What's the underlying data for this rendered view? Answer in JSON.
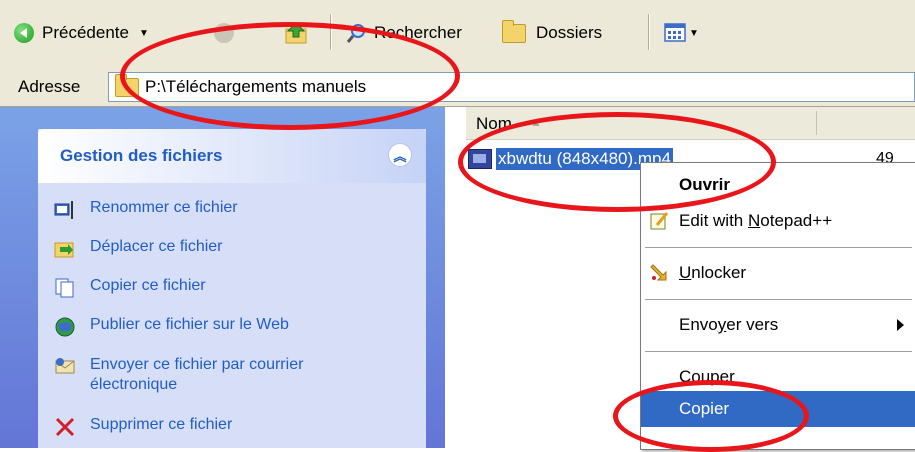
{
  "toolbar": {
    "back_label": "Précédente",
    "search_label": "Rechercher",
    "folders_label": "Dossiers"
  },
  "address": {
    "label": "Adresse",
    "path": "P:\\Téléchargements manuels"
  },
  "task_panel": {
    "title": "Gestion des fichiers",
    "tasks": [
      {
        "label": "Renommer ce fichier",
        "icon": "rename-icon"
      },
      {
        "label": "Déplacer ce fichier",
        "icon": "move-icon"
      },
      {
        "label": "Copier ce fichier",
        "icon": "copy-icon"
      },
      {
        "label": "Publier ce fichier sur le Web",
        "icon": "globe-icon"
      },
      {
        "label": "Envoyer ce fichier par courrier",
        "label2": "électronique",
        "icon": "mail-icon"
      },
      {
        "label": "Supprimer ce fichier",
        "icon": "delete-icon"
      }
    ]
  },
  "file_list": {
    "column_name": "Nom",
    "files": [
      {
        "name": "xbwdtu (848x480).mp4",
        "size": "49",
        "selected": true
      }
    ]
  },
  "context_menu": {
    "items": [
      {
        "label": "Ouvrir",
        "bold": true
      },
      {
        "label": "Edit with Notepad++",
        "icon": "notepad-icon"
      },
      {
        "label": "Unlocker",
        "icon": "unlocker-icon"
      },
      {
        "label": "Envoyer vers",
        "submenu": true
      },
      {
        "label": "Couper"
      },
      {
        "label": "Copier",
        "selected": true
      }
    ]
  },
  "annotation_color": "#e8161a"
}
